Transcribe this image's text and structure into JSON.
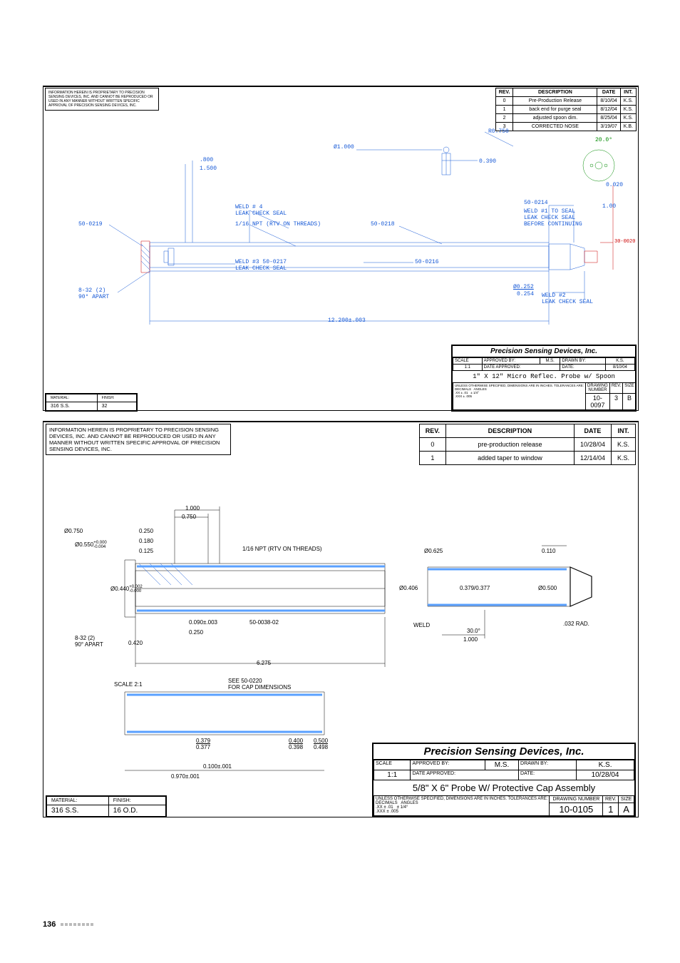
{
  "page_number": "136",
  "proprietary_text": "INFORMATION HEREIN IS PROPRIETARY TO PRECISION SENSING DEVICES, INC. AND CANNOT BE REPRODUCED OR USED IN ANY MANNER WITHOUT WRITTEN SPECIFIC APPROVAL OF PRECISION SENSING DEVICES, INC.",
  "drawings": [
    {
      "id": "top",
      "revisions": {
        "headers": {
          "rev": "REV.",
          "desc": "DESCRIPTION",
          "date": "DATE",
          "int": "INT."
        },
        "rows": [
          {
            "rev": "0",
            "desc": "Pre-Production Release",
            "date": "8/10/04",
            "int": "K.S."
          },
          {
            "rev": "1",
            "desc": "back end for purge seal",
            "date": "8/12/04",
            "int": "K.S."
          },
          {
            "rev": "2",
            "desc": "adjusted spoon dim.",
            "date": "8/25/04",
            "int": "K.S."
          },
          {
            "rev": "3",
            "desc": "CORRECTED NOSE",
            "date": "3/19/07",
            "int": "K.B."
          }
        ]
      },
      "titleblock": {
        "company": "Precision Sensing Devices, Inc.",
        "scale_lbl": "SCALE",
        "scale": "1:1",
        "apprby_lbl": "APPROVED BY:",
        "apprby": "M.S.",
        "drawnby_lbl": "DRAWN BY:",
        "drawnby": "K.S.",
        "dateappr_lbl": "DATE APPROVED:",
        "dateappr": "",
        "date_lbl": "DATE:",
        "date": "8/10/04",
        "title": "1\" X 12\" Micro Reflec. Probe  w/  Spoon",
        "tol_text": "UNLESS OTHERWISE SPECIFIED, DIMENSIONS ARE IN INCHES. TOLERANCES ARE:\nDECIMALS   ANGLES\n.XX ± .01   ± 1/4°\n.XXX ± .005",
        "dwgno_lbl": "DRAWING NUMBER",
        "dwgno": "10-0097",
        "rev_lbl": "REV.",
        "rev": "3",
        "size_lbl": "SIZE",
        "size": "B"
      },
      "material": {
        "mat_lbl": "MATERIAL:",
        "mat": "316 S.S.",
        "fin_lbl": "FINISH:",
        "fin": "32"
      },
      "annotations": {
        "a1": "Ø1.000",
        "a2": ".800",
        "a3": "1.500",
        "a4": "50-0219",
        "a5": "WELD # 4\nLEAK CHECK SEAL",
        "a6": "1/16 NPT (RTV ON THREADS)",
        "a7": "WELD #3 50-0217\nLEAK CHECK SEAL",
        "a8": "8-32 (2)\n90° APART",
        "a9": "12.200±.003",
        "a10": "R0.750",
        "a11": "20.0°",
        "a12": "0.390",
        "a13": "0.020",
        "a14": "1.00",
        "a15": "50-0218",
        "a16": "50-0214",
        "a17": "WELD #1 TO SEAL\nLEAK CHECK SEAL\nBEFORE CONTINUING",
        "a18": "50-0216",
        "a19": "Ø0.252",
        "a20": "0.254",
        "a21": "WELD #2\nLEAK CHECK SEAL",
        "a22": "30-0020"
      }
    },
    {
      "id": "bottom",
      "revisions": {
        "headers": {
          "rev": "REV.",
          "desc": "DESCRIPTION",
          "date": "DATE",
          "int": "INT."
        },
        "rows": [
          {
            "rev": "0",
            "desc": "pre-production release",
            "date": "10/28/04",
            "int": "K.S."
          },
          {
            "rev": "1",
            "desc": "added taper to window",
            "date": "12/14/04",
            "int": "K.S."
          }
        ]
      },
      "titleblock": {
        "company": "Precision Sensing Devices, Inc.",
        "scale_lbl": "SCALE",
        "scale": "1:1",
        "apprby_lbl": "APPROVED BY:",
        "apprby": "M.S.",
        "drawnby_lbl": "DRAWN BY:",
        "drawnby": "K.S.",
        "dateappr_lbl": "DATE APPROVED:",
        "dateappr": "",
        "date_lbl": "DATE:",
        "date": "10/28/04",
        "title": "5/8\" X 6\" Probe W/ Protective Cap Assembly",
        "tol_text": "UNLESS OTHERWISE SPECIFIED, DIMENSIONS ARE IN INCHES. TOLERANCES ARE:\nDECIMALS   ANGLES\n.XX ± .01   ± 1/4°\n.XXX ± .005",
        "dwgno_lbl": "DRAWING NUMBER",
        "dwgno": "10-0105",
        "rev_lbl": "REV.",
        "rev": "1",
        "size_lbl": "SIZE",
        "size": "A"
      },
      "material": {
        "mat_lbl": "MATERIAL:",
        "mat": "316 S.S.",
        "fin_lbl": "FINISH:",
        "fin": "16 O.D."
      },
      "annotations": {
        "b1": "1.000",
        "b2": "0.750",
        "b3": "Ø0.750",
        "b4": "0.250",
        "b5": "0.180",
        "b6": "Ø0.550",
        "b6t": "+0.000\n-0.004",
        "b7": "0.125",
        "b8": "1/16 NPT (RTV ON THREADS)",
        "b9": "Ø0.440",
        "b9t": "+0.002\n-0.000",
        "b10": "0.090±.003",
        "b11": "50-0038-02",
        "b12": "0.250",
        "b13": "8-32 (2)\n90° APART",
        "b14": "0.420",
        "b15": "6.275",
        "b16": "SCALE 2:1",
        "b17": "SEE 50-0220\nFOR CAP DIMENSIONS",
        "b18": "0.379",
        "b18b": "0.377",
        "b19": "0.400",
        "b19b": "0.398",
        "b20": "0.500",
        "b20b": "0.498",
        "b21": "0.100±.001",
        "b22": "0.970±.001",
        "b23": "Ø0.625",
        "b24": "0.110",
        "b25": "Ø0.406",
        "b26": "0.379/0.377",
        "b27": "Ø0.500",
        "b28": "WELD",
        "b29": "30.0°",
        "b30": "1.000",
        "b31": ".032 RAD."
      }
    }
  ]
}
